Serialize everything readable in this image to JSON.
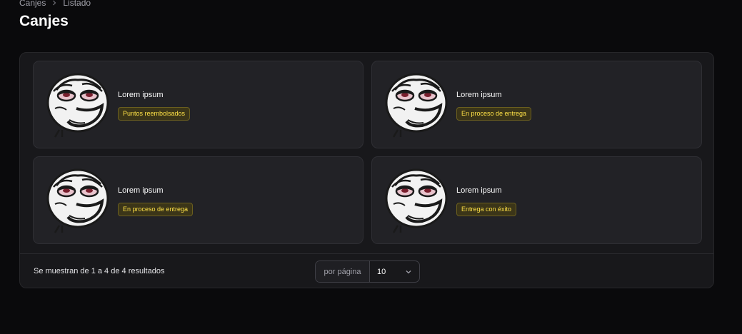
{
  "breadcrumb": {
    "items": [
      "Canjes",
      "Listado"
    ]
  },
  "page": {
    "title": "Canjes"
  },
  "cards": [
    {
      "title": "Lorem ipsum",
      "status": "Puntos reembolsados"
    },
    {
      "title": "Lorem ipsum",
      "status": "En proceso de entrega"
    },
    {
      "title": "Lorem ipsum",
      "status": "En proceso de entrega"
    },
    {
      "title": "Lorem ipsum",
      "status": "Entrega con éxito"
    }
  ],
  "footer": {
    "results_text": "Se muestran de 1 a 4 de 4 resultados",
    "per_page_label": "por página",
    "per_page_value": "10"
  },
  "colors": {
    "background": "#0a0a0c",
    "panel": "#18181b",
    "card": "#222226",
    "badge_text": "#fde047",
    "badge_bg": "#3b3518"
  },
  "icons": {
    "breadcrumb_separator": "chevron-right-icon",
    "card_avatar": "meme-face-avatar",
    "select_chevron": "chevron-down-icon"
  }
}
